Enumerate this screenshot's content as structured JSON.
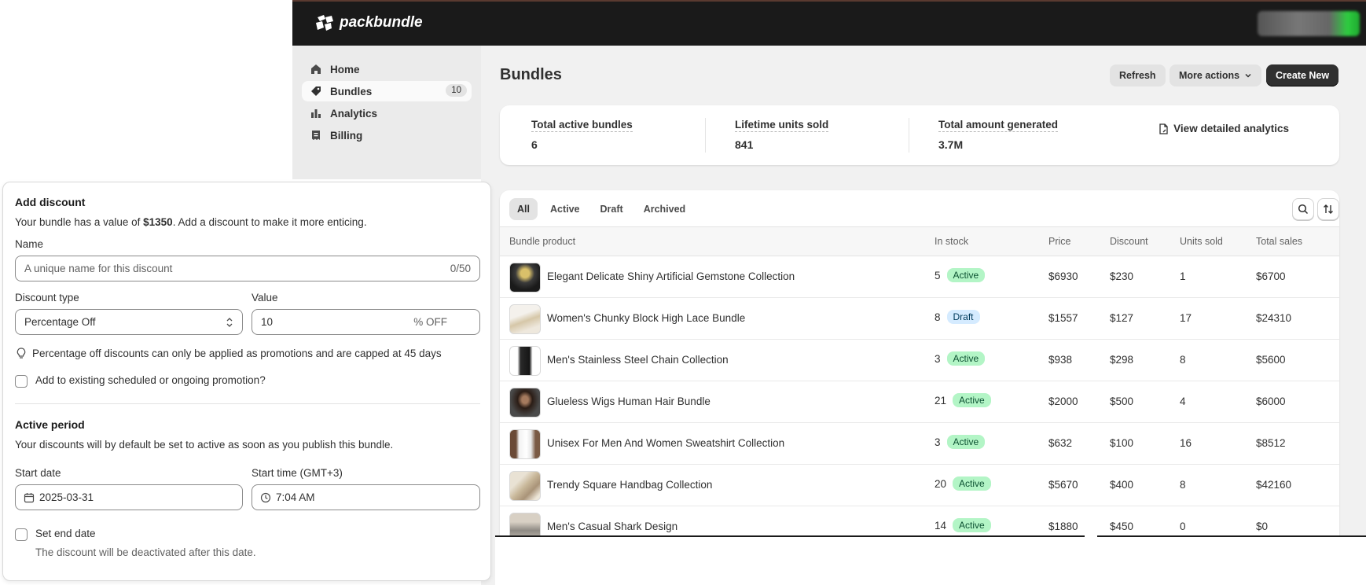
{
  "app": {
    "brand": "packbundle",
    "colors": {
      "topbar": "#1a1a1a",
      "active_badge": "#b3f5c6",
      "draft_badge": "#d5ebff",
      "primary_button": "#303030"
    }
  },
  "nav": {
    "items": [
      {
        "label": "Home",
        "icon": "home-icon"
      },
      {
        "label": "Bundles",
        "icon": "tag-icon",
        "badge": "10",
        "selected": true
      },
      {
        "label": "Analytics",
        "icon": "bar-chart-icon"
      },
      {
        "label": "Billing",
        "icon": "receipt-icon"
      }
    ]
  },
  "header": {
    "title": "Bundles",
    "refresh_label": "Refresh",
    "more_actions_label": "More actions",
    "create_label": "Create New"
  },
  "stats": {
    "items": [
      {
        "label": "Total active bundles",
        "value": "6"
      },
      {
        "label": "Lifetime units sold",
        "value": "841"
      },
      {
        "label": "Total amount generated",
        "value": "3.7M"
      }
    ],
    "view_analytics_label": "View detailed analytics"
  },
  "tabs": [
    "All",
    "Active",
    "Draft",
    "Archived"
  ],
  "table": {
    "columns": [
      "Bundle product",
      "In stock",
      "Price",
      "Discount",
      "Units sold",
      "Total sales"
    ],
    "rows": [
      {
        "name": "Elegant Delicate Shiny Artificial Gemstone Collection",
        "stock": "5",
        "status": "Active",
        "price": "$6930",
        "discount": "$230",
        "units": "1",
        "sales": "$6700"
      },
      {
        "name": "Women's Chunky Block High Lace Bundle",
        "stock": "8",
        "status": "Draft",
        "price": "$1557",
        "discount": "$127",
        "units": "17",
        "sales": "$24310"
      },
      {
        "name": "Men's Stainless Steel Chain Collection",
        "stock": "3",
        "status": "Active",
        "price": "$938",
        "discount": "$298",
        "units": "8",
        "sales": "$5600"
      },
      {
        "name": "Glueless Wigs Human Hair Bundle",
        "stock": "21",
        "status": "Active",
        "price": "$2000",
        "discount": "$500",
        "units": "4",
        "sales": "$6000"
      },
      {
        "name": "Unisex For Men And Women Sweatshirt Collection",
        "stock": "3",
        "status": "Active",
        "price": "$632",
        "discount": "$100",
        "units": "16",
        "sales": "$8512"
      },
      {
        "name": "Trendy Square Handbag Collection",
        "stock": "20",
        "status": "Active",
        "price": "$5670",
        "discount": "$400",
        "units": "8",
        "sales": "$42160"
      },
      {
        "name": "Men's Casual Shark Design",
        "stock": "14",
        "status": "Active",
        "price": "$1880",
        "discount": "$450",
        "units": "0",
        "sales": "$0"
      }
    ]
  },
  "discount": {
    "title": "Add discount",
    "intro_prefix": "Your bundle has a value of ",
    "intro_value": "$1350",
    "intro_suffix": ". Add a discount to make it more enticing.",
    "name_label": "Name",
    "name_placeholder": "A unique name for this discount",
    "name_counter": "0/50",
    "type_label": "Discount type",
    "type_value": "Percentage Off",
    "value_label": "Value",
    "value_value": "10",
    "value_suffix": "% OFF",
    "hint": "Percentage off discounts can only be applied as promotions and are capped at 45 days",
    "promo_checkbox_label": "Add to existing scheduled or ongoing promotion?",
    "active_period_title": "Active period",
    "active_period_text": "Your discounts will by default be set to active as soon as you publish this bundle.",
    "start_date_label": "Start date",
    "start_date_value": "2025-03-31",
    "start_time_label": "Start time (GMT+3)",
    "start_time_value": "7:04 AM",
    "end_date_label": "Set end date",
    "end_date_help": "The discount will be deactivated after this date."
  }
}
